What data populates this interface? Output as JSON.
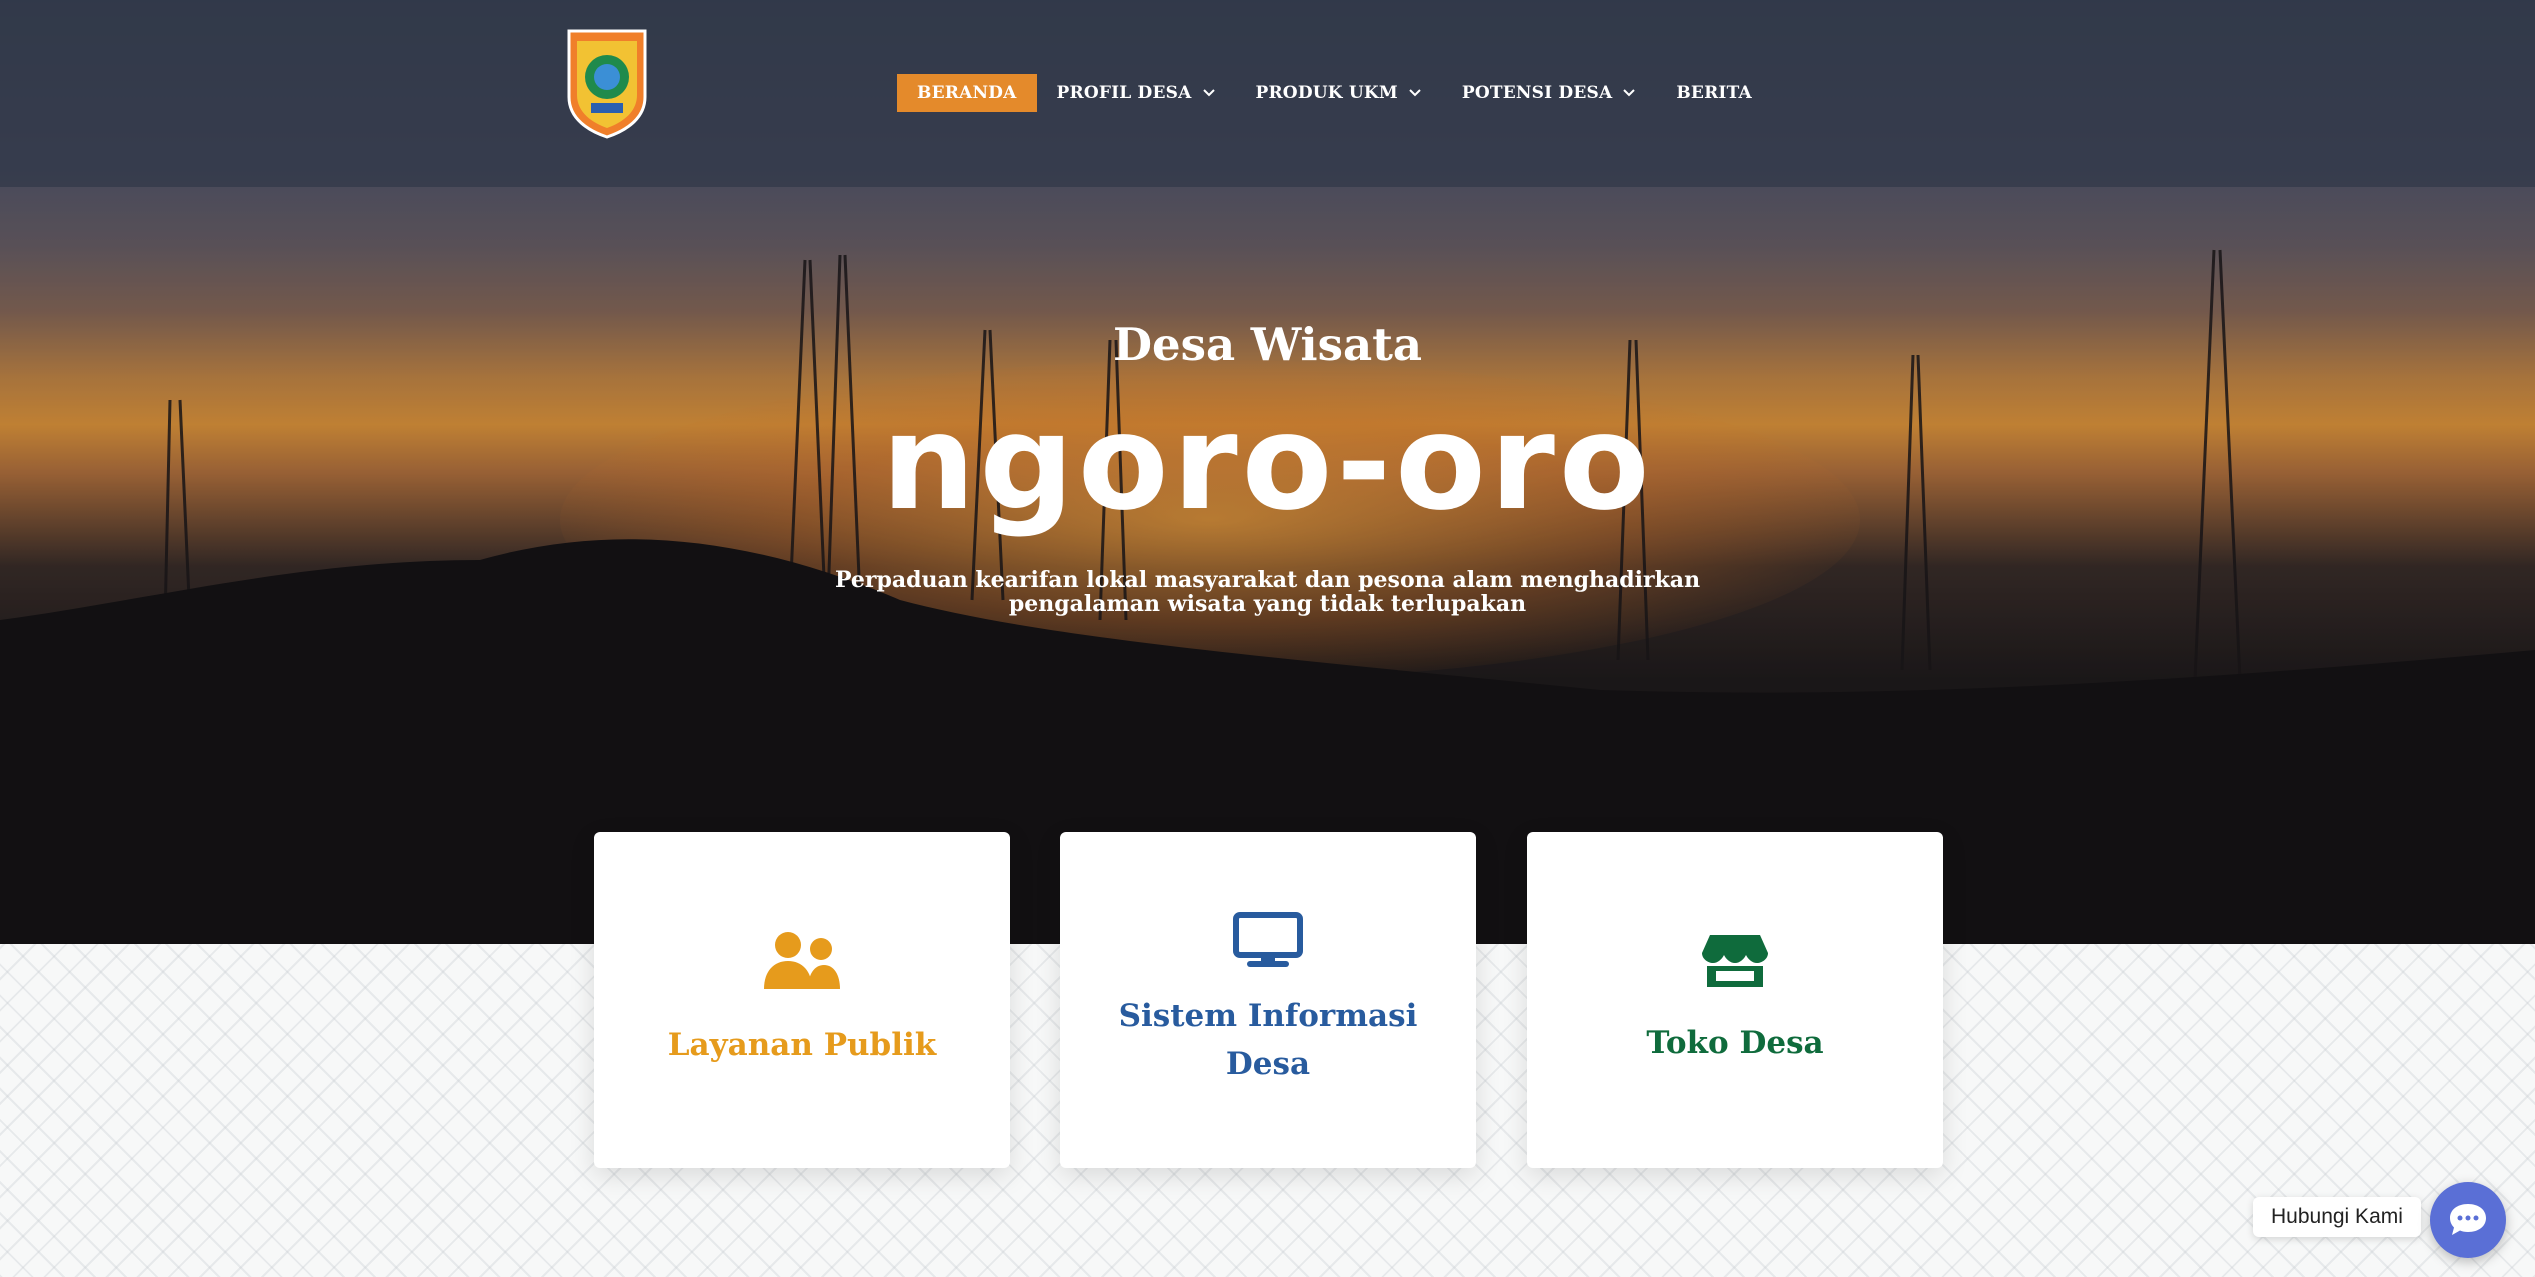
{
  "header": {
    "nav": [
      {
        "label": "BERANDA",
        "active": true,
        "has_dropdown": false
      },
      {
        "label": "PROFIL DESA",
        "active": false,
        "has_dropdown": true
      },
      {
        "label": "PRODUK UKM",
        "active": false,
        "has_dropdown": true
      },
      {
        "label": "POTENSI DESA",
        "active": false,
        "has_dropdown": true
      },
      {
        "label": "BERITA",
        "active": false,
        "has_dropdown": false
      }
    ],
    "logo_icon": "village-crest-icon"
  },
  "hero": {
    "subtitle": "Desa Wisata",
    "brand": "ngoro-oro",
    "tagline_line1": "Perpaduan kearifan lokal masyarakat dan pesona alam menghadirkan",
    "tagline_line2": "pengalaman wisata yang tidak terlupakan"
  },
  "cards": [
    {
      "title": "Layanan Publik",
      "icon": "users-icon",
      "color": "#e69b1c"
    },
    {
      "title": "Sistem Informasi Desa",
      "icon": "monitor-icon",
      "color": "#285b9e"
    },
    {
      "title": "Toko Desa",
      "icon": "store-icon",
      "color": "#0f6b3c"
    }
  ],
  "contact": {
    "label": "Hubungi Kami",
    "icon": "chat-icon",
    "color": "#5a6fd6"
  },
  "colors": {
    "accent": "#e48a2b"
  }
}
